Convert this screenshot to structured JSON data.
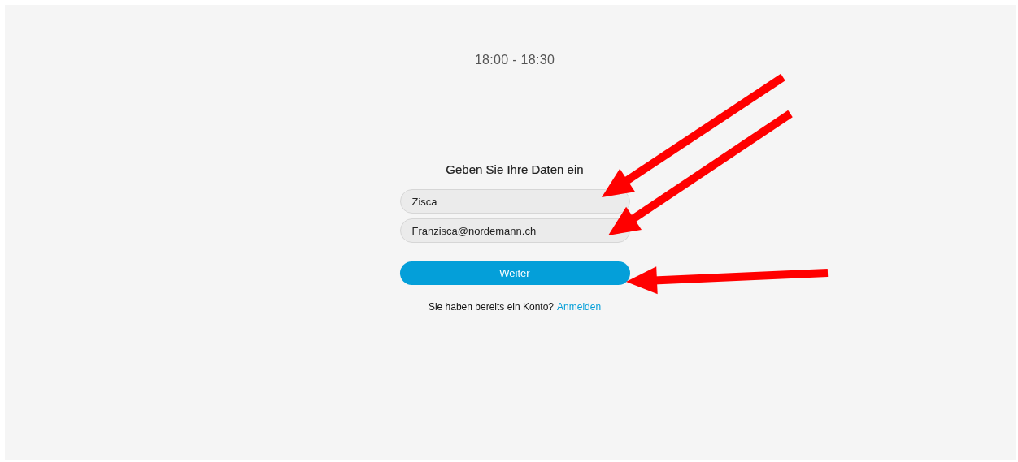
{
  "time_range": "18:00 - 18:30",
  "form": {
    "heading": "Geben Sie Ihre Daten ein",
    "fields": [
      {
        "value": "Zisca"
      },
      {
        "value": "Franzisca@nordemann.ch"
      }
    ],
    "submit_button": "Weiter",
    "login_prompt": {
      "text": "Sie haben bereits ein Konto?",
      "link": "Anmelden"
    }
  }
}
